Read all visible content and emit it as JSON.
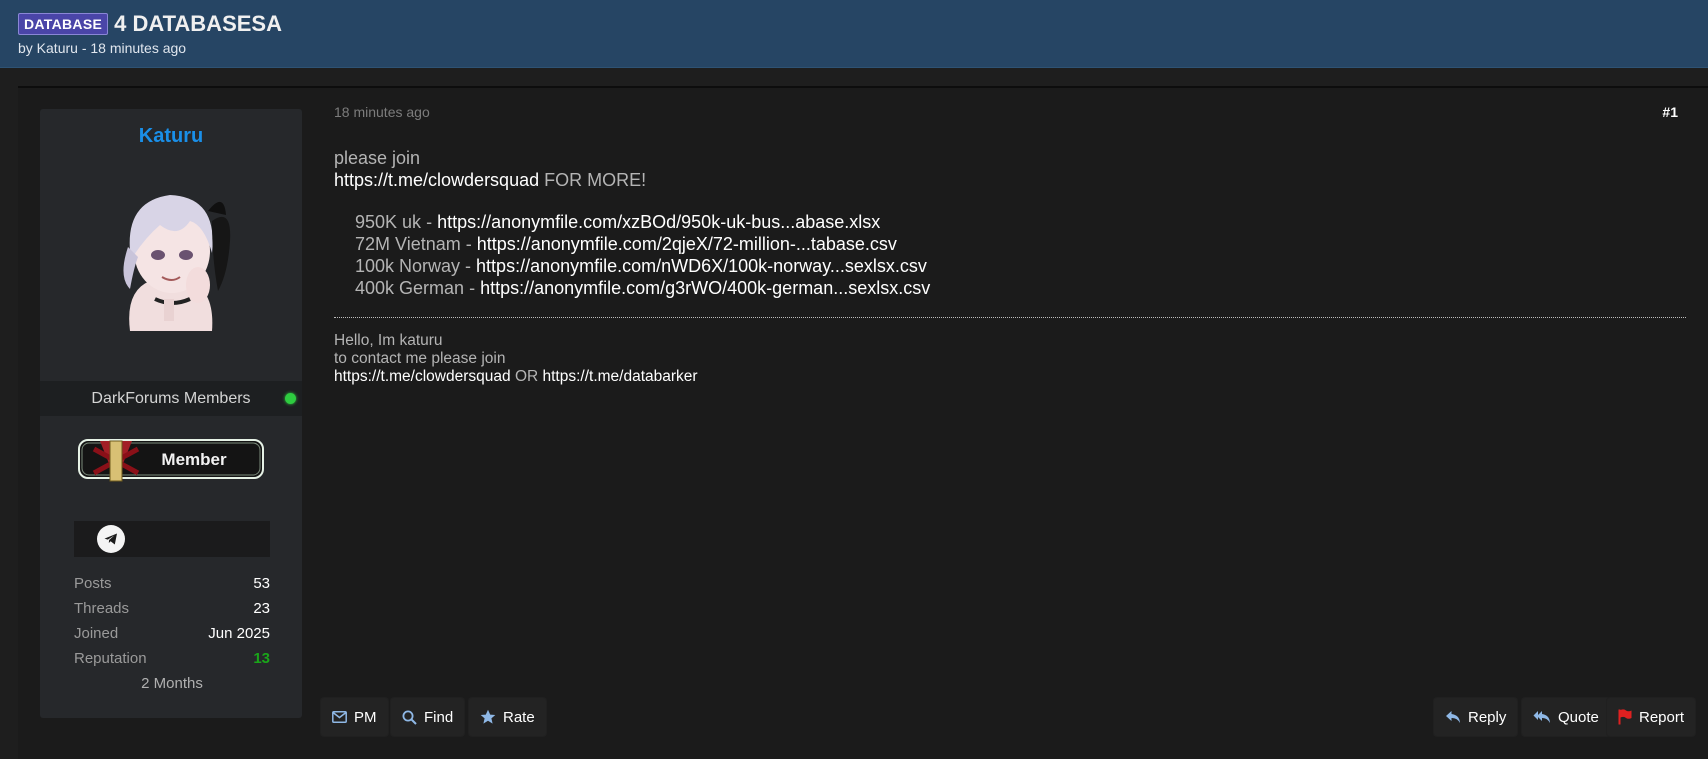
{
  "thread": {
    "prefix": "DATABASE",
    "title": "4 DATABASESA",
    "byline": "by Katuru - 18 minutes ago"
  },
  "author": {
    "name": "Katuru",
    "group": "DarkForums Members",
    "rank_label": "Member",
    "stats": [
      {
        "label": "Posts",
        "value": "53"
      },
      {
        "label": "Threads",
        "value": "23"
      },
      {
        "label": "Joined",
        "value": "Jun 2025"
      },
      {
        "label": "Reputation",
        "value": "13"
      }
    ],
    "extra": "2 Months"
  },
  "post": {
    "date": "18 minutes ago",
    "number": "#1",
    "intro": "please join",
    "intro_link": "https://t.me/clowdersquad",
    "intro_suffix": "FOR MORE!",
    "items": [
      {
        "label": "950K uk",
        "sep": " - ",
        "url": "https://anonymfile.com/xzBOd/950k-uk-bus...abase.xlsx"
      },
      {
        "label": "72M Vietnam",
        "sep": " - ",
        "url": "https://anonymfile.com/2qjeX/72-million-...tabase.csv"
      },
      {
        "label": "100k Norway",
        "sep": " - ",
        "url": "https://anonymfile.com/nWD6X/100k-norway...sexlsx.csv"
      },
      {
        "label": "400k German",
        "sep": " - ",
        "url": "https://anonymfile.com/g3rWO/400k-german...sexlsx.csv"
      }
    ],
    "signature": {
      "line1": "Hello, Im katuru",
      "line2": "to contact me please join",
      "link1": "https://t.me/clowdersquad",
      "or": "OR",
      "link2": "https://t.me/databarker"
    }
  },
  "actions": {
    "pm": "PM",
    "find": "Find",
    "rate": "Rate",
    "reply": "Reply",
    "quote": "Quote",
    "report": "Report"
  },
  "colors": {
    "header_bg": "#264564",
    "username": "#1a8fe8",
    "reputation": "#1aa51a",
    "report_flag": "#e02020"
  },
  "icons": [
    "telegram-icon",
    "envelope-icon",
    "search-icon",
    "star-icon",
    "reply-icon",
    "quote-icon",
    "flag-icon",
    "online-dot"
  ]
}
